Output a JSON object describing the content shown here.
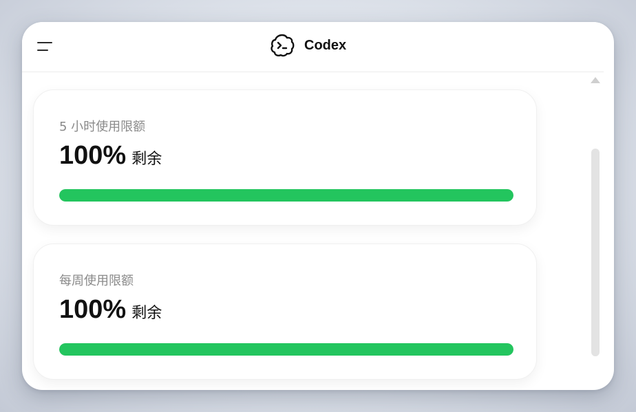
{
  "header": {
    "app_name": "Codex",
    "menu_icon": "hamburger-menu-icon",
    "logo_icon": "codex-cloud-terminal-icon"
  },
  "usage_cards": [
    {
      "label": "5 小时使用限额",
      "percent": "100%",
      "suffix": "剩余",
      "progress": 1.0
    },
    {
      "label": "每周使用限额",
      "percent": "100%",
      "suffix": "剩余",
      "progress": 1.0
    }
  ],
  "colors": {
    "progress": "#23c55e",
    "track": "#e6e6e6",
    "label": "#8a8a8a",
    "text": "#111111"
  }
}
